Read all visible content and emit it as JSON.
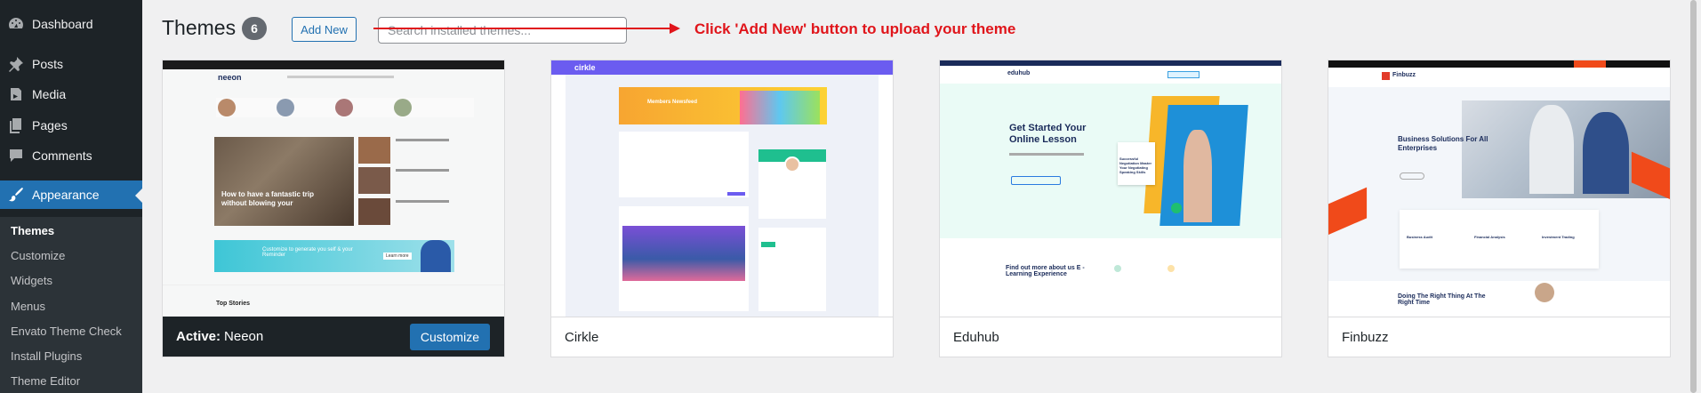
{
  "sidebar": {
    "items": [
      {
        "label": "Dashboard",
        "icon": "dashboard-icon"
      },
      {
        "label": "Posts",
        "icon": "pin-icon"
      },
      {
        "label": "Media",
        "icon": "media-icon"
      },
      {
        "label": "Pages",
        "icon": "pages-icon"
      },
      {
        "label": "Comments",
        "icon": "comments-icon"
      },
      {
        "label": "Appearance",
        "icon": "paintbrush-icon"
      }
    ],
    "submenu": [
      "Themes",
      "Customize",
      "Widgets",
      "Menus",
      "Envato Theme Check",
      "Install Plugins",
      "Theme Editor"
    ]
  },
  "header": {
    "title": "Themes",
    "count": "6",
    "add_new_label": "Add New",
    "search_placeholder": "Search installed themes...",
    "annotation": "Click 'Add New' button to upload your theme"
  },
  "themes": [
    {
      "name": "Neeon",
      "active_prefix": "Active:",
      "customize_label": "Customize",
      "preview": {
        "logo": "neeon",
        "hero_caption": "How to have a fantastic trip without blowing your",
        "banner_text": "Customize to generate you self & your Reminder",
        "banner_button": "Learn more",
        "section": "Top Stories"
      }
    },
    {
      "name": "Cirkle",
      "preview": {
        "logo": "cirkle",
        "banner_text": "Members Newsfeed"
      }
    },
    {
      "name": "Eduhub",
      "preview": {
        "logo": "eduhub",
        "headline": "Get Started Your Online Lesson",
        "card_text": "Successful Negotiation Master Your Negotiating Speaking Skills",
        "lower_heading": "Find out more about us E - Learning Experience"
      }
    },
    {
      "name": "Finbuzz",
      "preview": {
        "logo": "Finbuzz",
        "headline": "Business Solutions For All Enterprises",
        "cards": [
          "Business Audit",
          "Financial Analysis",
          "Investment Trading"
        ],
        "lower_heading": "Doing The Right Thing At The Right Time"
      }
    }
  ],
  "colors": {
    "sidebar_bg": "#1d2327",
    "accent": "#2271b1",
    "annotation_red": "#e0151b"
  }
}
